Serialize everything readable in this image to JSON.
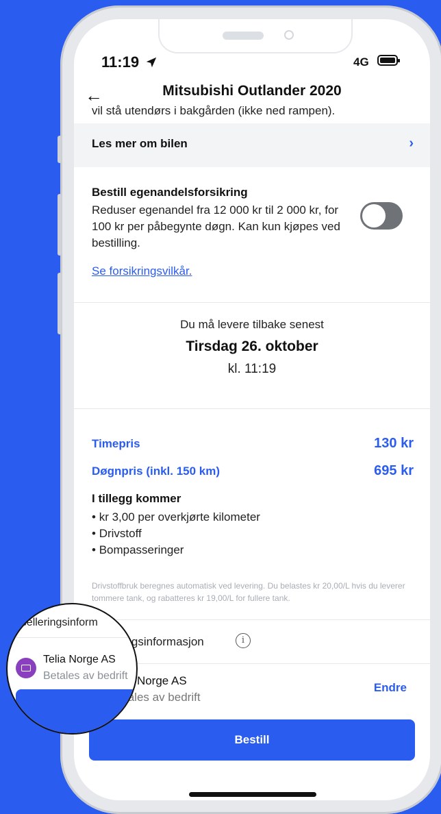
{
  "status": {
    "time": "11:19",
    "network": "4G"
  },
  "nav": {
    "title": "Mitsubishi Outlander 2020"
  },
  "cut_text": "vil stå utendørs i bakgården (ikke ned rampen).",
  "more": {
    "label": "Les mer om bilen"
  },
  "insurance": {
    "title": "Bestill egenandelsforsikring",
    "description": "Reduser egenandel fra 12 000 kr til 2 000 kr, for 100 kr per påbegynte døgn. Kan kun kjøpes ved bestilling.",
    "link": "Se forsikringsvilkår.",
    "toggle_on": false
  },
  "return": {
    "note": "Du må levere tilbake senest",
    "date": "Tirsdag 26. oktober",
    "time": "kl. 11:19"
  },
  "prices": [
    {
      "label": "Timepris",
      "value": "130 kr"
    },
    {
      "label": "Døgnpris (inkl. 150 km)",
      "value": "695 kr"
    }
  ],
  "extras": {
    "title": "I tillegg kommer",
    "items": [
      "kr 3,00 per overkjørte kilometer",
      "Drivstoff",
      "Bompasseringer"
    ]
  },
  "fine_print": "Drivstoffbruk beregnes automatisk ved levering. Du belastes kr 20,00/L hvis du leverer tommere tank, og rabatteres kr 19,00/L for fullere tank.",
  "cancellation": {
    "label": "lleringsinformasjon"
  },
  "payment": {
    "name": "ia Norge AS",
    "sub": "tales av bedrift",
    "edit": "Endre"
  },
  "order_button": "Bestill",
  "magnifier": {
    "cancel_label": "ansselleringsinform",
    "name": "Telia Norge AS",
    "sub": "Betales av bedrift"
  },
  "colors": {
    "accent": "#2a5cf0",
    "icon_purple": "#8a3fbf"
  }
}
